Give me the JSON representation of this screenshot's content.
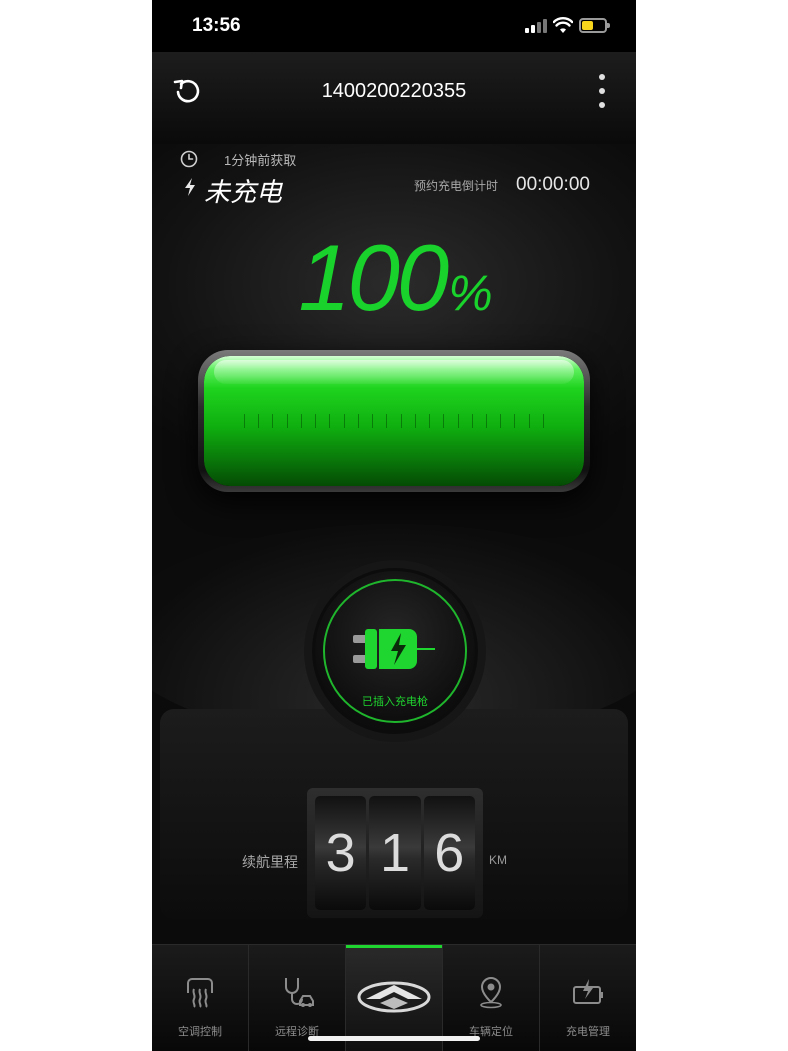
{
  "status_bar": {
    "time": "13:56"
  },
  "header": {
    "title": "1400200220355",
    "refresh_icon": "refresh-icon",
    "more_icon": "more-vertical-icon"
  },
  "charge_status": {
    "fetched_text": "1分钟前获取",
    "state": "未充电",
    "countdown_label": "预约充电倒计时",
    "countdown_value": "00:00:00"
  },
  "battery": {
    "level_percent": 100,
    "percent_number": "100",
    "percent_sign": "%",
    "fill_color": "#19d22b"
  },
  "plug": {
    "label": "已插入充电枪"
  },
  "range": {
    "label": "续航里程",
    "digits": [
      "3",
      "1",
      "6"
    ],
    "unit": "KM"
  },
  "tabs": [
    {
      "label": "空调控制",
      "icon": "air-conditioner-icon"
    },
    {
      "label": "远程诊断",
      "icon": "stethoscope-car-icon"
    },
    {
      "label": "",
      "icon": "brand-logo-icon",
      "active": true
    },
    {
      "label": "车辆定位",
      "icon": "location-pin-icon"
    },
    {
      "label": "充电管理",
      "icon": "charging-battery-icon"
    }
  ]
}
